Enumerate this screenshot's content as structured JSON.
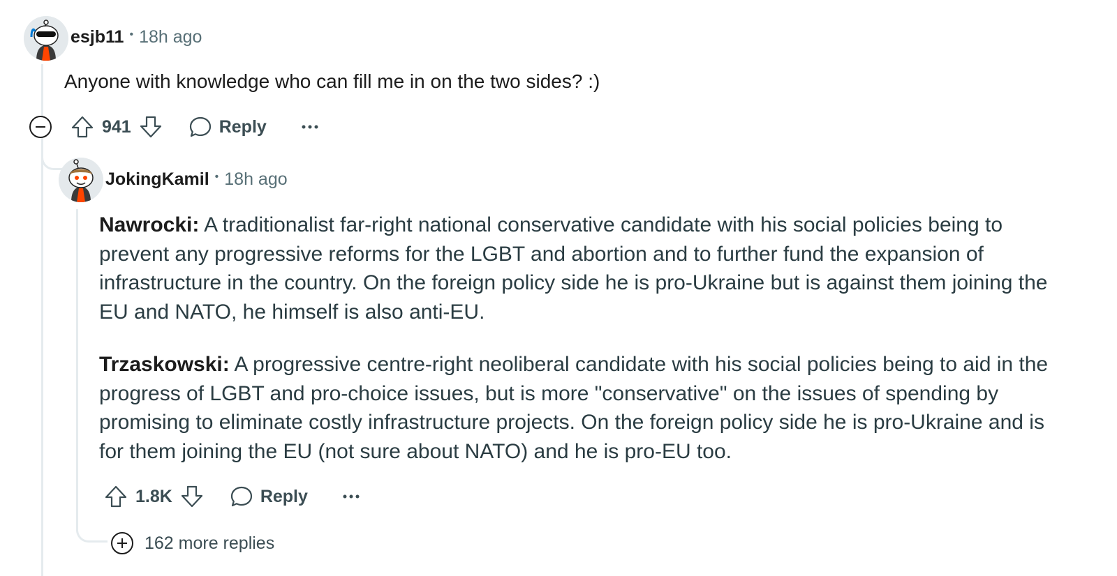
{
  "comment": {
    "author": "esjb11",
    "timestamp": "18h ago",
    "text": "Anyone with knowledge who can fill me in on the two sides? :)",
    "score": "941",
    "reply_label": "Reply",
    "collapse_icon": "collapse-minus-icon"
  },
  "reply": {
    "author": "JokingKamil",
    "timestamp": "18h ago",
    "paragraphs": [
      {
        "bold": "Nawrocki:",
        "text": " A traditionalist far-right national conservative candidate with his social policies being to prevent any progressive reforms for the LGBT and abortion and to further fund the expansion of infrastructure in the country. On the foreign policy side he is pro-Ukraine but is against them joining the EU and NATO, he himself is also anti-EU."
      },
      {
        "bold": "Trzaskowski:",
        "text": " A progressive centre-right neoliberal candidate with his social policies being to aid in the progress of LGBT and pro-choice issues, but is more \"conservative\" on the issues of spending by promising to eliminate costly infrastructure projects. On the foreign policy side he is pro-Ukraine and is for them joining the EU (not sure about NATO) and he is pro-EU too."
      }
    ],
    "score": "1.8K",
    "reply_label": "Reply",
    "more_replies": "162 more replies"
  },
  "icons": {
    "upvote": "upvote-arrow-icon",
    "downvote": "downvote-arrow-icon",
    "reply": "speech-bubble-icon",
    "more": "ellipsis-icon",
    "expand": "expand-plus-icon"
  },
  "colors": {
    "text_primary": "#1c1c1c",
    "text_secondary": "#576f76",
    "thread_line": "#e5ebee",
    "background": "#ffffff"
  }
}
